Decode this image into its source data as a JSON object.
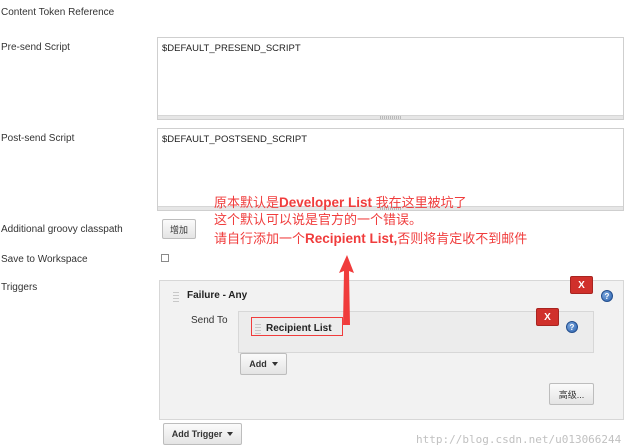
{
  "labels": {
    "content_token_reference": "Content Token Reference",
    "pre_send_script": "Pre-send Script",
    "post_send_script": "Post-send Script",
    "additional_groovy_classpath": "Additional groovy classpath",
    "save_to_workspace": "Save to Workspace",
    "triggers": "Triggers"
  },
  "pre_send": {
    "value": "$DEFAULT_PRESEND_SCRIPT"
  },
  "post_send": {
    "value": "$DEFAULT_POSTSEND_SCRIPT"
  },
  "buttons": {
    "add_classpath": "增加",
    "add": "Add",
    "advanced": "高级...",
    "add_trigger": "Add Trigger",
    "delete": "X",
    "help": "?"
  },
  "trigger": {
    "title": "Failure - Any",
    "send_to_label": "Send To",
    "recipient": "Recipient List"
  },
  "annotation": {
    "line1_prefix": "原本默认是",
    "line1_highlight": "Developer List",
    "line1_suffix": " 我在这里被坑了",
    "line2": "这个默认可以说是官方的一个错误。",
    "line3_prefix": "请自行添加一个",
    "line3_highlight": "Recipient List,",
    "line3_suffix": "否则将肯定收不到邮件"
  },
  "watermark": "http://blog.csdn.net/u013066244",
  "colors": {
    "annotation": "#f03c3c",
    "delete_button": "#d0302b",
    "help_icon": "#2d63b0"
  }
}
